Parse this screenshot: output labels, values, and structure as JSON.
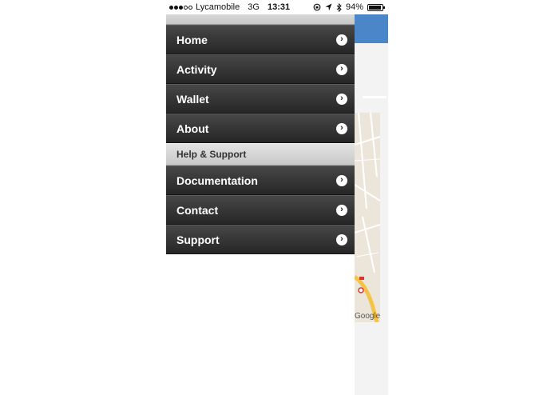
{
  "status_bar": {
    "signal": [
      "full",
      "full",
      "full",
      "empty",
      "empty"
    ],
    "carrier": "Lycamobile",
    "network": "3G",
    "time": "13:31",
    "icons": [
      "orientation-lock-icon",
      "location-arrow-icon",
      "bluetooth-icon"
    ],
    "battery_percent": "94%",
    "battery_level": 0.94
  },
  "menu": {
    "items": [
      {
        "label": "Home",
        "chevron": "›"
      },
      {
        "label": "Activity",
        "chevron": "›"
      },
      {
        "label": "Wallet",
        "chevron": "›"
      },
      {
        "label": "About",
        "chevron": "›"
      }
    ],
    "section": {
      "title": "Help & Support",
      "items": [
        {
          "label": "Documentation",
          "chevron": "›"
        },
        {
          "label": "Contact",
          "chevron": "›"
        },
        {
          "label": "Support",
          "chevron": "›"
        }
      ]
    }
  },
  "background": {
    "map_attribution": "Google",
    "header_color": "#4a86c8"
  }
}
